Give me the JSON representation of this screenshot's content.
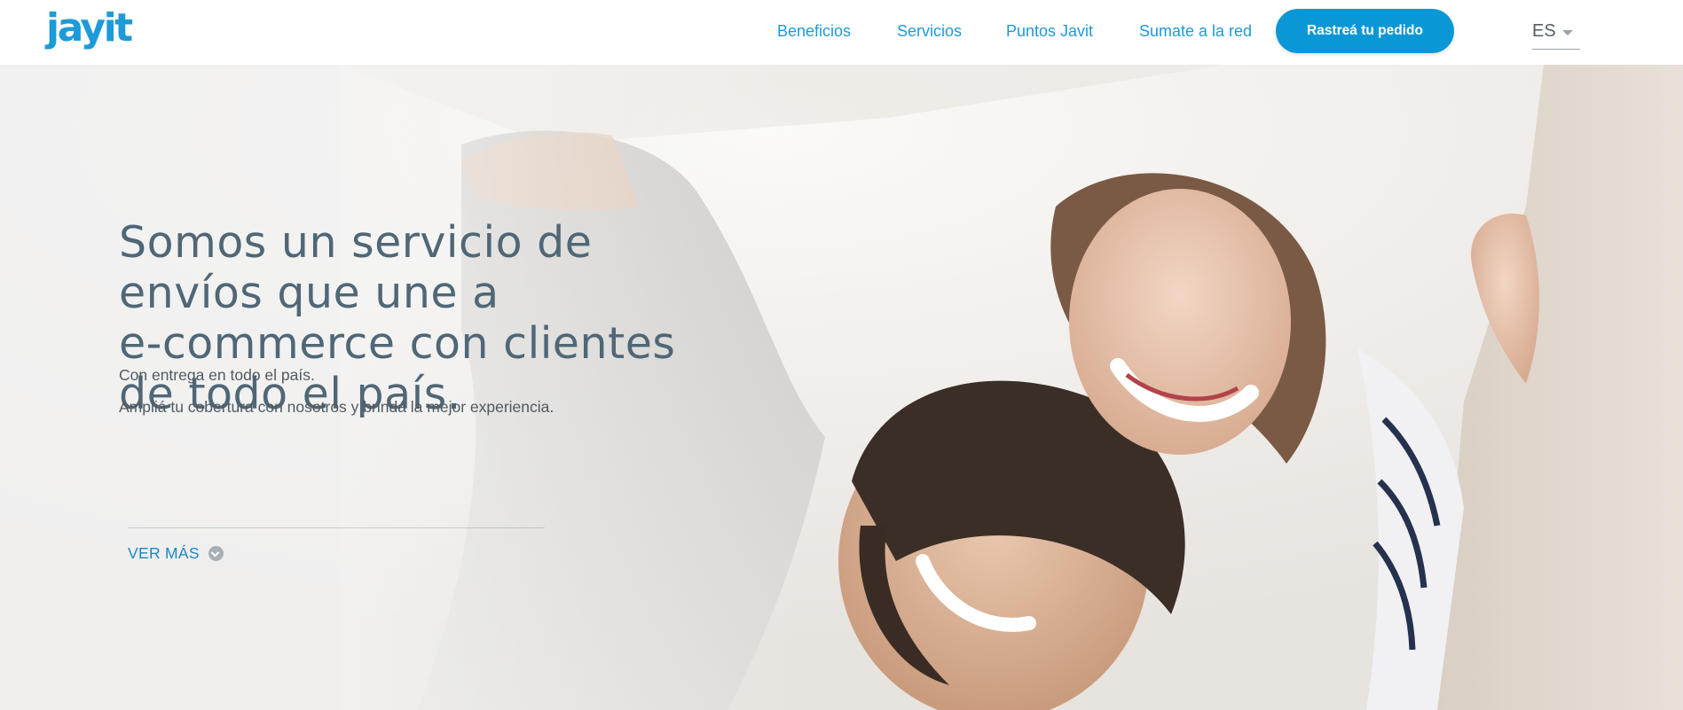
{
  "brand": {
    "logo_text": "jayit",
    "accent_color": "#1d9ad8",
    "button_color": "#0b97d6"
  },
  "nav": {
    "links": [
      {
        "label": "Beneficios"
      },
      {
        "label": "Servicios"
      },
      {
        "label": "Puntos Javit"
      },
      {
        "label": "Sumate a la red"
      }
    ],
    "track_button": "Rastreá tu pedido",
    "language": {
      "selected": "ES",
      "icon": "caret-down-icon"
    }
  },
  "hero": {
    "headline_lines": [
      "Somos un servicio de",
      "envíos que une a",
      "e-commerce con clientes",
      "de todo el país."
    ],
    "subtitle_1": "Con entrega en todo el país.",
    "subtitle_2": "Ampliá tu cobertura con nosotros y brindá la mejor experiencia.",
    "more_label": "VER MÁS",
    "more_icon": "chevron-down-circle-icon"
  }
}
